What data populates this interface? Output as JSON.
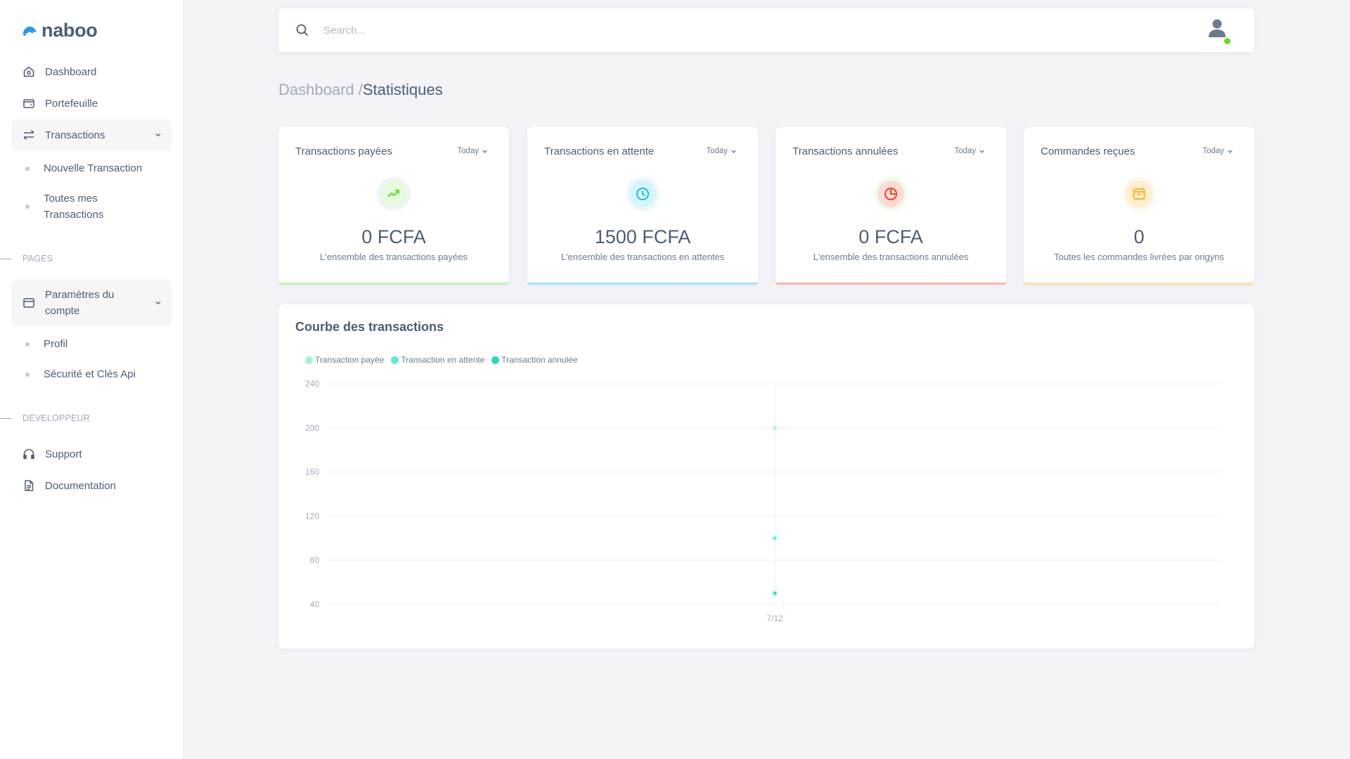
{
  "brand": {
    "name": "naboo",
    "logo_color": "#2b9ae0"
  },
  "sidebar": {
    "items": [
      {
        "label": "Dashboard",
        "icon": "home-icon"
      },
      {
        "label": "Portefeuille",
        "icon": "wallet-icon"
      },
      {
        "label": "Transactions",
        "icon": "transfer-arrows-icon",
        "expanded": true,
        "children": [
          {
            "label": "Nouvelle Transaction"
          },
          {
            "label": "Toutes mes Transactions"
          }
        ]
      }
    ],
    "sections": [
      {
        "label": "PAGES",
        "items": [
          {
            "label": "Paramètres du compte",
            "icon": "browser-window-icon",
            "expanded": true,
            "children": [
              {
                "label": "Profil"
              },
              {
                "label": "Sécurité et Clés Api"
              }
            ]
          }
        ]
      },
      {
        "label": "DEVELOPPEUR",
        "items": [
          {
            "label": "Support",
            "icon": "headset-icon"
          },
          {
            "label": "Documentation",
            "icon": "document-icon"
          }
        ]
      }
    ]
  },
  "topbar": {
    "search_placeholder": "Search...",
    "search_value": "",
    "user_status": "online"
  },
  "breadcrumb": {
    "parent": "Dashboard /",
    "current": "Statistiques"
  },
  "stats": [
    {
      "title": "Transactions payées",
      "filter": "Today",
      "icon": "trending-up-icon",
      "value": "0 FCFA",
      "description": "L'ensemble des transactions payées",
      "accent": "#6ad62d"
    },
    {
      "title": "Transactions en attente",
      "filter": "Today",
      "icon": "clock-icon",
      "value": "1500 FCFA",
      "description": "L'ensemble des transactions en attentes",
      "accent": "#16bfe0"
    },
    {
      "title": "Transactions annulées",
      "filter": "Today",
      "icon": "pie-chart-icon",
      "value": "0 FCFA",
      "description": "L'ensemble des transactions annulées",
      "accent": "#f0401f"
    },
    {
      "title": "Commandes reçues",
      "filter": "Today",
      "icon": "archive-box-icon",
      "value": "0",
      "description": "Toutes les commandes livrées par origyns",
      "accent": "#fdb022"
    }
  ],
  "chart_card": {
    "title": "Courbe des transactions"
  },
  "chart_data": {
    "type": "line",
    "title": "Courbe des transactions",
    "xlabel": "",
    "ylabel": "",
    "x": [
      "7/12"
    ],
    "series": [
      {
        "name": "Transaction payée",
        "color": "#a7f3d0",
        "values": [
          200
        ]
      },
      {
        "name": "Transaction en attente",
        "color": "#5eead4",
        "values": [
          100
        ]
      },
      {
        "name": "Transaction annulée",
        "color": "#2dd4bf",
        "values": [
          50
        ]
      }
    ],
    "yticks": [
      40,
      80,
      120,
      160,
      200,
      240
    ],
    "ylim": [
      40,
      240
    ],
    "grid": true,
    "legend": "top-left"
  }
}
